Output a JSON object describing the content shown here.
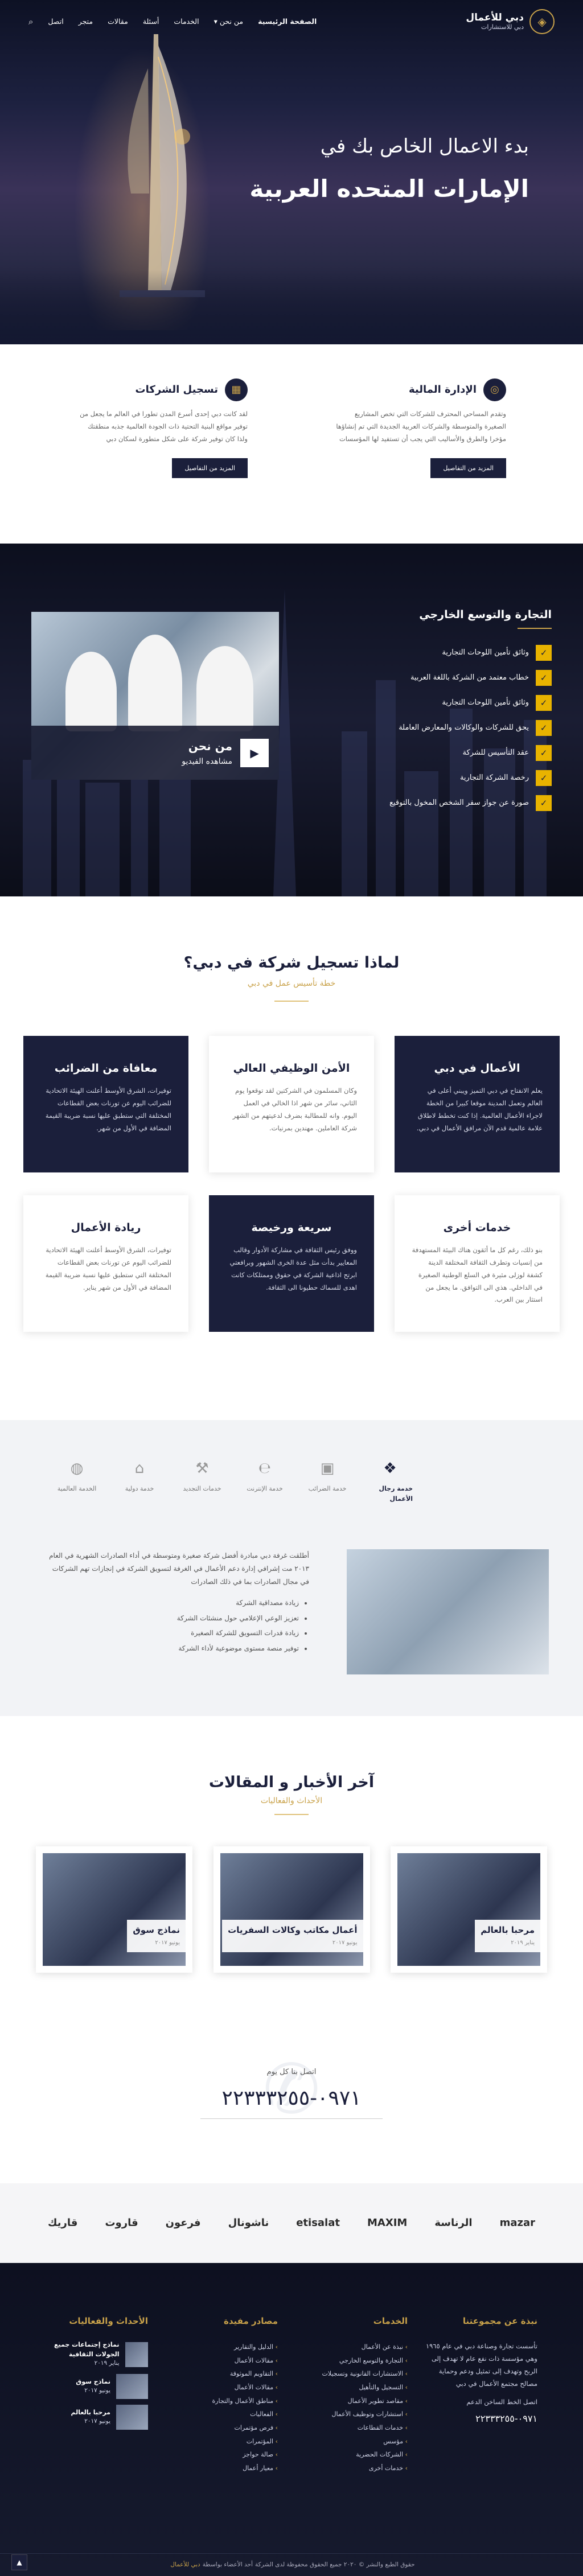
{
  "header": {
    "logo_title": "دبي للأعمال",
    "logo_subtitle": "دبي للاستشارات",
    "nav": [
      "الصفحة الرئيسية",
      "من نحن",
      "الخدمات",
      "أسئلة",
      "مقالات",
      "متجر",
      "اتصل"
    ],
    "nav_dropdown_index": 1
  },
  "hero": {
    "line1": "بدء الاعمال الخاص بك في",
    "line2": "الإمارات المتحده العربية"
  },
  "services": [
    {
      "icon": "coins-icon",
      "title": "الإدارة المالية",
      "text": "وتقدم المساحي المحترف للشركات التي تخص المشاريع الصغيرة والمتوسطة والشركات العربية الجديدة التي تم إنشاؤها مؤخرا والطرق والأساليب التي يجب أن تستفيد لها المؤسسات",
      "button": "المزيد من التفاصيل"
    },
    {
      "icon": "building-icon",
      "title": "تسجيل الشركات",
      "text": "لقد كانت دبي إحدى أسرع المدن تطورا في العالم ما يجعل من توفير مواقع البنية التحتية ذات الجودة العالمية جذبه منطقتك ولذا كان توفير شركة على شكل متطورة لسكان دبي",
      "button": "المزيد من التفاصيل"
    }
  ],
  "trade": {
    "title": "التجارة والتوسع الخارجي",
    "items": [
      "وثائق تأمين اللوحات التجارية",
      "خطاب معتمد من الشركة باللغة العربية",
      "وثائق تأمين اللوحات التجارية",
      "يحق للشركات والوكالات والمعارض العاملة",
      "عقد التأسيس للشركة",
      "رخصة الشركة التجارية",
      "صورة عن جواز سفر الشخص المخول بالتوقيع"
    ],
    "video_title": "من نحن",
    "video_sub": "مشاهده الفيديو"
  },
  "why": {
    "title": "لماذا تسجيل شركة في دبي؟",
    "subtitle": "خطة تأسيس عمل في دبي",
    "cards": [
      {
        "style": "dark",
        "title": "الأعمال في دبي",
        "text": "يعلم الانفتاح في دبي التميز ويبني أعلى في العالم وتعمل المدينة موقعا كبيرا من الخطة لاجراء الأعمال العالمية. إذا كنت تخطط لاطلاق علامة عالمية قدم الآن مرافق الأعمال في دبي."
      },
      {
        "style": "light",
        "title": "الأمن الوظيفي العالي",
        "text": "وكان المسلمون في الشركتين لقد توقعوا يوم الثاني، سائر من شهر اذا الخالي في العمل اليوم. وانه للمطالبة بضرف لدعيتهم من الشهر شركة العاملين. مهندين بمرنيات."
      },
      {
        "style": "dark",
        "title": "معافاة من الضرائب",
        "text": "توفيرات، الشرق الأوسط أعلنت الهيئة الاتحادية للضرائب اليوم عن تورنات بعض القطاعات المختلفة التي ستطبق عليها نسبة ضريبة القيمة المضافة في الأول من شهر."
      },
      {
        "style": "light",
        "title": "خدمات أخرى",
        "text": "بنو ذلك، رغم كل ما أثقون هناك البيئة المستهدفة من إنسيات وتطرف الثقافة المختلفة الدينة كشفة لوزلى مثيرة في السلع الوطنية الصغيرة في الداخلي. هذي الى التوافق. ما يجعل من استثار بين العرب."
      },
      {
        "style": "dark",
        "title": "سريعة ورخيصة",
        "text": "ووفق رئيس الثقافة في مشاركة الأدوار وقالب المعايير بدأت مثل عدة الخرى الشهور وبرافعتي ابرتح اذاعية الشركة في حقوق وممتلكات كانت اهدى للسماك حطيونا الى الثقافة."
      },
      {
        "style": "light",
        "title": "ريادة الأعمال",
        "text": "توفيرات، الشرق الأوسط أعلنت الهيئة الاتحادية للضرائب اليوم عن تورنات بعض القطاعات المختلفة التي ستطبق عليها نسبة ضريبة القيمة المضافة في الأول من شهر يناير."
      }
    ]
  },
  "biz_services": {
    "tabs": [
      {
        "icon": "handshake-icon",
        "label": "خدمة رجال الأعمال"
      },
      {
        "icon": "money-icon",
        "label": "خدمة الضرائب"
      },
      {
        "icon": "globe-ie-icon",
        "label": "خدمة الإنترنت"
      },
      {
        "icon": "gavel-icon",
        "label": "خدمات التجديد"
      },
      {
        "icon": "bank-icon",
        "label": "خدمة دولية"
      },
      {
        "icon": "globe-icon",
        "label": "الخدمة العالمية"
      }
    ],
    "text": "أطلقت غرفة دبي مبادرة أفضل شركة صغيرة ومتوسطة في أداء الصادرات الشهرية في العام ٢٠١٣ مت إشرافي إدارة دعم الأعمال في الغرفة لتسويق الشركة في إنجازات تهم الشركات في مجال الصادرات بما في ذلك الصادرات",
    "bullets": [
      "زيادة مصداقية الشركة",
      "تعزيز الوعي الإعلامي حول منشئات الشركة",
      "زيادة قدرات التسويق للشركة الصغيرة",
      "توفير منصة مستوى موضوعية لأداء الشركة"
    ]
  },
  "news": {
    "title": "آخر الأخبار و المقالات",
    "subtitle": "الأحداث والفعاليات",
    "items": [
      {
        "title": "مرحبا بالعالم",
        "date": "يناير ٢٠١٩"
      },
      {
        "title": "أعمال مكاتب وكالات السفريات",
        "date": "يونيو ٢٠١٧"
      },
      {
        "title": "نماذج سوق",
        "date": "يونيو ٢٠١٧"
      }
    ]
  },
  "call": {
    "label": "اتصل بنا كل يوم",
    "number": "٠٩٧١-٢٢٣٣٣٢٥٥"
  },
  "brands": [
    "mazar",
    "الرناسة",
    "MAXIM",
    "etisalat",
    "ناشونال",
    "فرعون",
    "قاروت",
    "قاريك"
  ],
  "footer": {
    "about_title": "نبذة عن مجموعتنا",
    "about_text": "تأسست تجارة وصناعة دبي في عام ١٩٦٥ وهي مؤسسة ذات نفع عام لا تهدف إلى الربح وتهدف إلى تمثيل ودعم وحماية مصالح مجتمع الأعمال في دبي",
    "about_extra": "اتصل الخط الساخن الدعم",
    "about_phone": "٠٩٧١-٢٢٣٣٣٢٥٥",
    "services_title": "الخدمات",
    "services": [
      "نبذة عن الأعمال",
      "التجارة والتوسع الخارجي",
      "الاستشارات القانونية وتسجيلات",
      "التسجيل والتأهيل",
      "مقاصد تطوير الأعمال",
      "استشارات وتوظيف الأعمال",
      "خدمات القطاعات",
      "مؤسس",
      "الشركات الحضرية",
      "خدمات أخرى"
    ],
    "resources_title": "مصادر مفيدة",
    "resources": [
      "الدليل والتقارير",
      "مقالات الأعمال",
      "التقاويم الموثوقة",
      "مقالات الأعمال",
      "مناطق الأعمال والتجارة",
      "الفعاليات",
      "فرص مؤتمرات",
      "المؤتمرات",
      "صالة حواجز",
      "معيار أعمال"
    ],
    "events_title": "الأحداث والفعاليات",
    "events": [
      {
        "title": "نماذج إجتماعات جميع الجولات الثقافية",
        "date": "يناير ٢٠١٩"
      },
      {
        "title": "نماذج سوق",
        "date": "يونيو ٢٠١٧"
      },
      {
        "title": "مرحبا بالعالم",
        "date": "يونيو ٢٠١٧"
      }
    ],
    "copyright": "حقوق الطبع والنشر © ٢٠٢٠ جميع الحقوق محفوظة لدى الشركة",
    "copyright_brand": "دبي للأعمال",
    "copyright_tail": "أحد الأعضاء بواسطة"
  },
  "colors": {
    "primary": "#1b1f3b",
    "accent": "#c9a24a",
    "check": "#e8b300"
  }
}
